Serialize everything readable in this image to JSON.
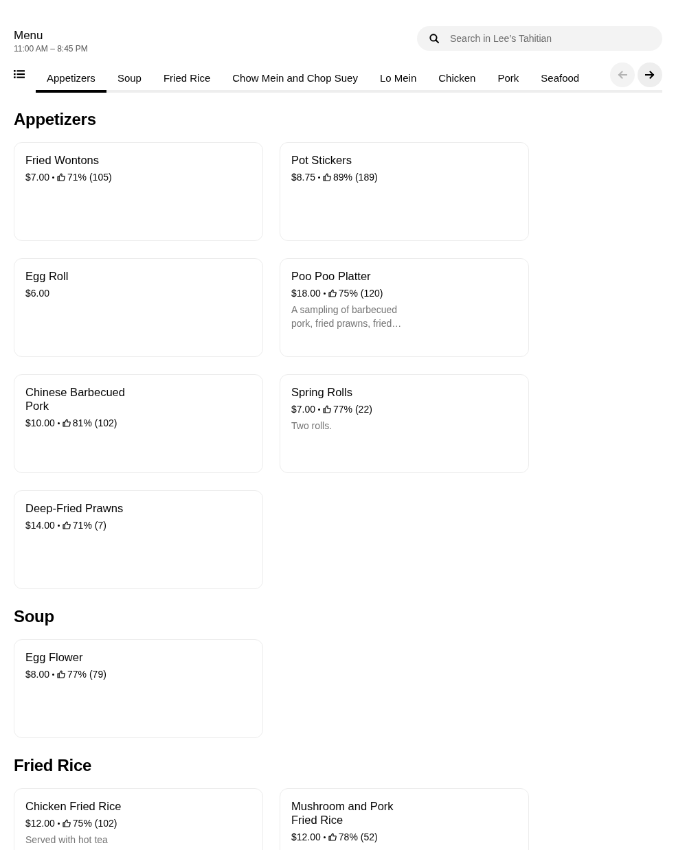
{
  "header": {
    "title": "Menu",
    "hours": "11:00 AM – 8:45 PM"
  },
  "search": {
    "placeholder": "Search in Lee’s Tahitian"
  },
  "tabs": [
    {
      "label": "Appetizers",
      "selected": true
    },
    {
      "label": "Soup",
      "selected": false
    },
    {
      "label": "Fried Rice",
      "selected": false
    },
    {
      "label": "Chow Mein and Chop Suey",
      "selected": false
    },
    {
      "label": "Lo Mein",
      "selected": false
    },
    {
      "label": "Chicken",
      "selected": false
    },
    {
      "label": "Pork",
      "selected": false
    },
    {
      "label": "Seafood",
      "selected": false
    }
  ],
  "scroll_buttons": [
    {
      "kind": "back",
      "disabled": true
    },
    {
      "kind": "forward",
      "disabled": false
    }
  ],
  "sections": [
    {
      "title": "Appetizers",
      "items": [
        {
          "name": "Fried Wontons",
          "price": "$7.00",
          "rating": "71% (105)"
        },
        {
          "name": "Pot Stickers",
          "price": "$8.75",
          "rating": "89% (189)"
        },
        {
          "name": "Egg Roll",
          "price": "$6.00"
        },
        {
          "name": "Poo Poo Platter",
          "price": "$18.00",
          "rating": "75% (120)",
          "description": "A sampling of barbecued pork, fried prawns, fried…"
        },
        {
          "name": "Chinese Barbecued Pork",
          "price": "$10.00",
          "rating": "81% (102)"
        },
        {
          "name": "Spring Rolls",
          "price": "$7.00",
          "rating": "77% (22)",
          "description": "Two rolls."
        },
        {
          "name": "Deep-Fried Prawns",
          "price": "$14.00",
          "rating": "71% (7)"
        }
      ]
    },
    {
      "title": "Soup",
      "items": [
        {
          "name": "Egg Flower",
          "price": "$8.00",
          "rating": "77% (79)"
        }
      ]
    },
    {
      "title": "Fried Rice",
      "items": [
        {
          "name": "Chicken Fried Rice",
          "price": "$12.00",
          "rating": "75% (102)",
          "description": "Served with hot tea"
        },
        {
          "name": "Mushroom and Pork Fried Rice",
          "price": "$12.00",
          "rating": "78% (52)"
        }
      ]
    }
  ]
}
